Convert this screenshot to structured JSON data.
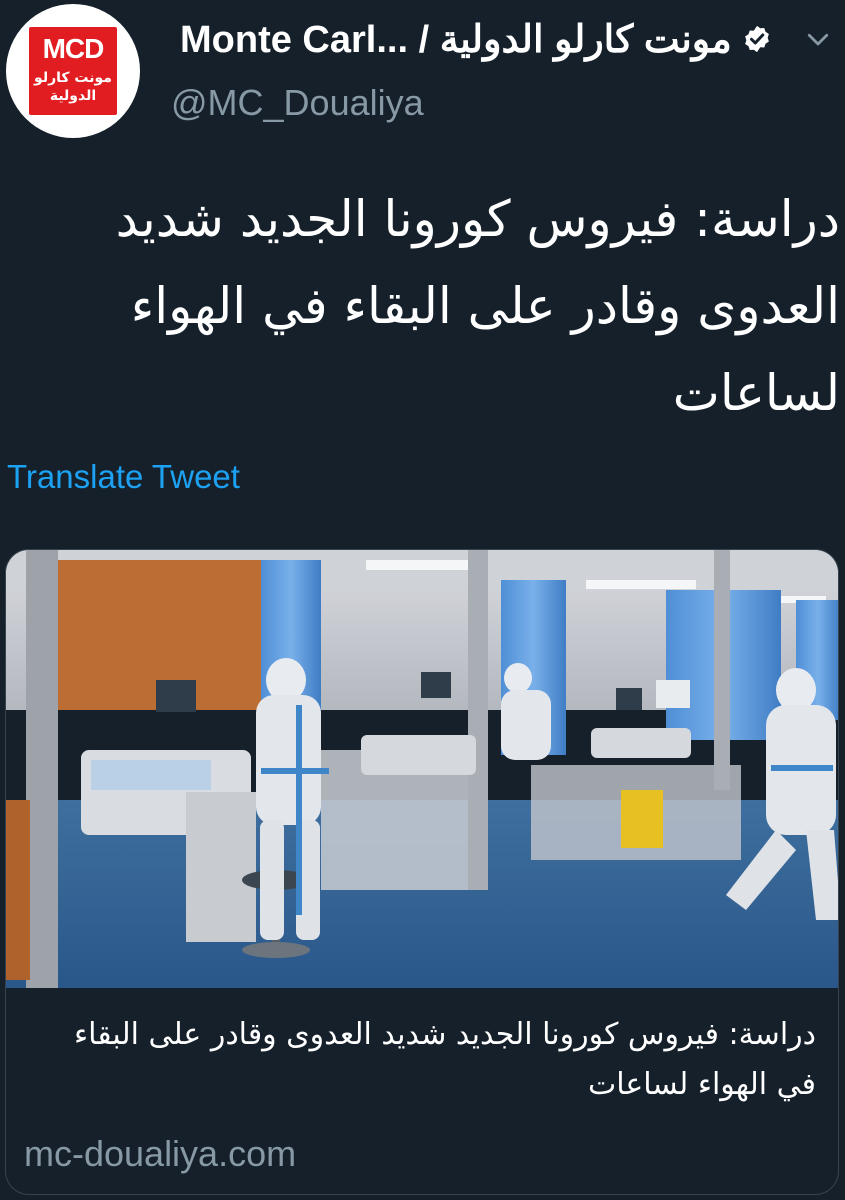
{
  "header": {
    "avatar_logo_text": "MCD",
    "avatar_logo_subtext": "مونت كارلو الدولية",
    "display_name": "Monte Carl... / مونت كارلو الدولية",
    "handle": "@MC_Doualiya",
    "verified_icon": "verified-badge-icon",
    "menu_icon": "chevron-down-icon"
  },
  "tweet": {
    "text": "دراسة: فيروس كورونا الجديد شديد العدوى وقادر على البقاء في الهواء لساعات",
    "translate_label": "Translate Tweet"
  },
  "card": {
    "image_description_icon": "hospital-icu-photo",
    "title": "دراسة: فيروس كورونا الجديد شديد العدوى وقادر على البقاء في الهواء لساعات",
    "domain": "mc-doualiya.com"
  },
  "colors": {
    "background": "#15202b",
    "text_primary": "#ffffff",
    "text_secondary": "#8899a6",
    "link": "#1da1f2",
    "brand_red": "#e11d22"
  }
}
